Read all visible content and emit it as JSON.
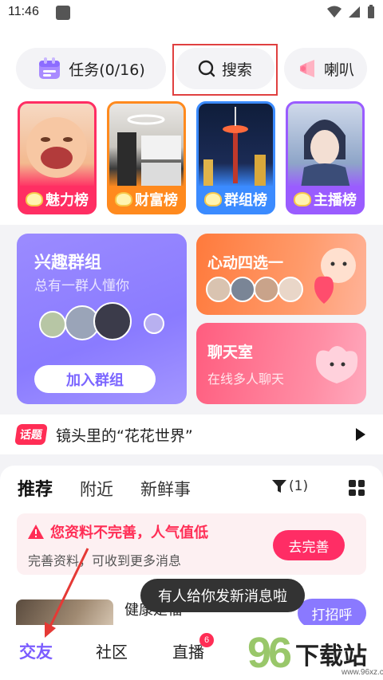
{
  "status_bar": {
    "time": "11:46"
  },
  "top_pills": {
    "task": "任务(0/16)",
    "search": "搜索",
    "horn": "喇叭"
  },
  "rank_cards": [
    {
      "label": "魅力榜",
      "color": "#ff2e63"
    },
    {
      "label": "财富榜",
      "color": "#ff8a1e"
    },
    {
      "label": "群组榜",
      "color": "#3b8bff"
    },
    {
      "label": "主播榜",
      "color": "#9a5cff"
    }
  ],
  "group_card": {
    "title": "兴趣群组",
    "subtitle": "总有一群人懂你",
    "join": "加入群组"
  },
  "heart_card": {
    "title": "心动四选一"
  },
  "chat_card": {
    "title": "聊天室",
    "subtitle": "在线多人聊天"
  },
  "topic": {
    "tag": "话题",
    "text": "镜头里的“花花世界”"
  },
  "feed": {
    "tabs": [
      "推荐",
      "附近",
      "新鲜事"
    ],
    "filter": "(1)",
    "warning_title": "您资料不完善，人气值低",
    "warning_sub": "完善资料，可收到更多消息",
    "warning_button": "去完善",
    "user_name": "健康是福",
    "greet_button": "打招呼"
  },
  "toast": "有人给你发新消息啦",
  "bottom_nav": {
    "items": [
      "交友",
      "社区",
      "直播"
    ],
    "live_badge": "6"
  },
  "watermark": {
    "number": "96",
    "text": "下载站",
    "url": "www.96xz.com"
  }
}
